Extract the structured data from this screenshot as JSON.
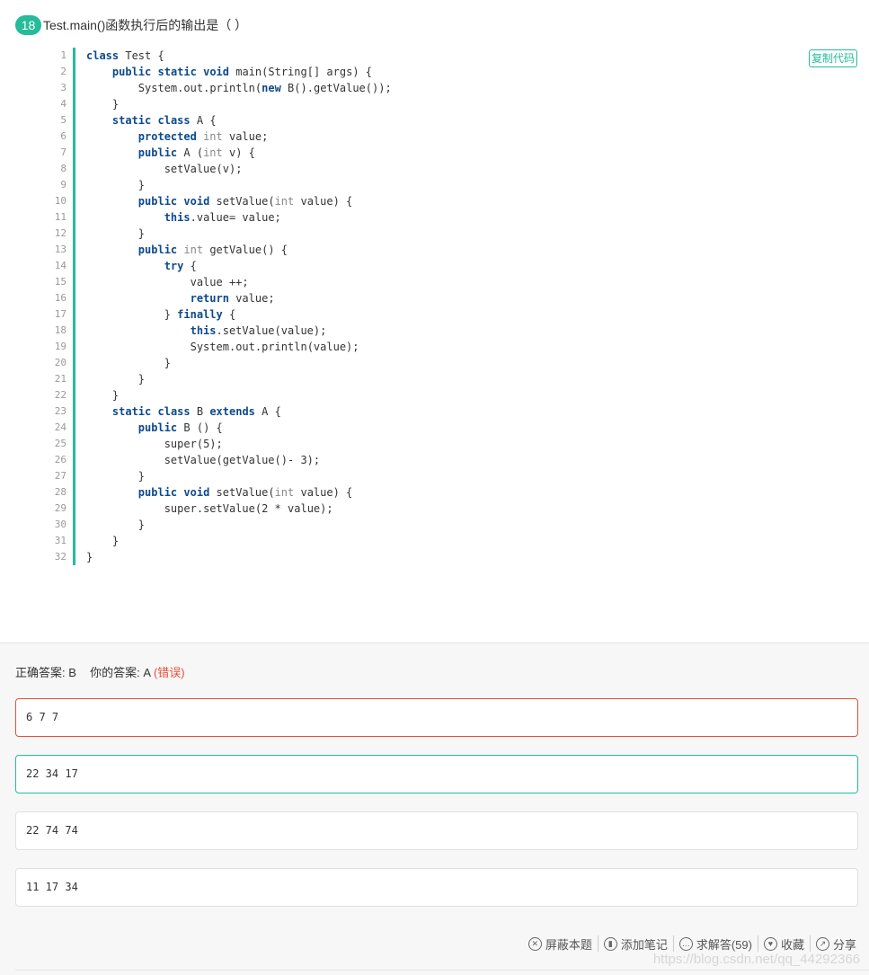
{
  "question": {
    "number": "18",
    "title": "Test.main()函数执行后的输出是（ ）",
    "copy_label": "复制代码"
  },
  "code": [
    {
      "n": "1",
      "t": "class Test {"
    },
    {
      "n": "2",
      "t": "    public static void main(String[] args) {"
    },
    {
      "n": "3",
      "t": "        System.out.println(new B().getValue());"
    },
    {
      "n": "4",
      "t": "    }"
    },
    {
      "n": "5",
      "t": "    static class A {"
    },
    {
      "n": "6",
      "t": "        protected int value;"
    },
    {
      "n": "7",
      "t": "        public A (int v) {"
    },
    {
      "n": "8",
      "t": "            setValue(v);"
    },
    {
      "n": "9",
      "t": "        }"
    },
    {
      "n": "10",
      "t": "        public void setValue(int value) {"
    },
    {
      "n": "11",
      "t": "            this.value= value;"
    },
    {
      "n": "12",
      "t": "        }"
    },
    {
      "n": "13",
      "t": "        public int getValue() {"
    },
    {
      "n": "14",
      "t": "            try {"
    },
    {
      "n": "15",
      "t": "                value ++;"
    },
    {
      "n": "16",
      "t": "                return value;"
    },
    {
      "n": "17",
      "t": "            } finally {"
    },
    {
      "n": "18",
      "t": "                this.setValue(value);"
    },
    {
      "n": "19",
      "t": "                System.out.println(value);"
    },
    {
      "n": "20",
      "t": "            }"
    },
    {
      "n": "21",
      "t": "        }"
    },
    {
      "n": "22",
      "t": "    }"
    },
    {
      "n": "23",
      "t": "    static class B extends A {"
    },
    {
      "n": "24",
      "t": "        public B () {"
    },
    {
      "n": "25",
      "t": "            super(5);"
    },
    {
      "n": "26",
      "t": "            setValue(getValue()- 3);"
    },
    {
      "n": "27",
      "t": "        }"
    },
    {
      "n": "28",
      "t": "        public void setValue(int value) {"
    },
    {
      "n": "29",
      "t": "            super.setValue(2 * value);"
    },
    {
      "n": "30",
      "t": "        }"
    },
    {
      "n": "31",
      "t": "    }"
    },
    {
      "n": "32",
      "t": "}"
    }
  ],
  "result": {
    "correct_label": "正确答案: B",
    "your_label": "你的答案: A",
    "status": "(错误)"
  },
  "options": [
    {
      "text": "6  7  7",
      "state": "err"
    },
    {
      "text": "22  34  17",
      "state": "ok"
    },
    {
      "text": "22  74  74",
      "state": ""
    },
    {
      "text": "11  17  34",
      "state": ""
    }
  ],
  "toolbar": {
    "block": "屏蔽本题",
    "note": "添加笔记",
    "ask": "求解答(59)",
    "fav": "收藏",
    "share": "分享"
  },
  "watermark": "https://blog.csdn.net/qq_44292366",
  "colors": {
    "accent": "#25bb9b",
    "error": "#e5503c"
  }
}
